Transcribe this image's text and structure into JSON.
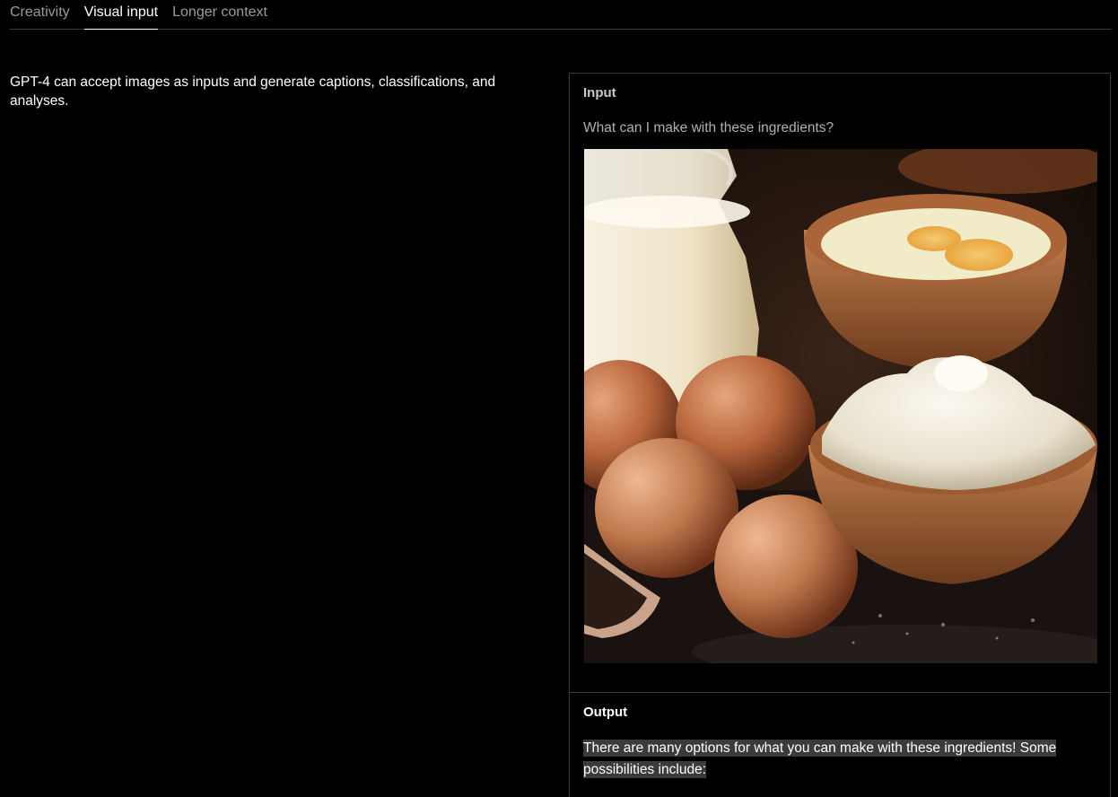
{
  "tabs": [
    {
      "label": "Creativity",
      "active": false
    },
    {
      "label": "Visual input",
      "active": true
    },
    {
      "label": "Longer context",
      "active": false
    }
  ],
  "description": "GPT-4 can accept images as inputs and generate captions, classifications, and analyses.",
  "panel": {
    "input_label": "Input",
    "prompt": "What can I make with these ingredients?",
    "output_label": "Output",
    "output_text": "There are many options for what you can make with these ingredients! Some possibilities include:"
  },
  "colors": {
    "background": "#000000",
    "border": "#3a3a3a",
    "highlight": "#3b3b3b"
  }
}
